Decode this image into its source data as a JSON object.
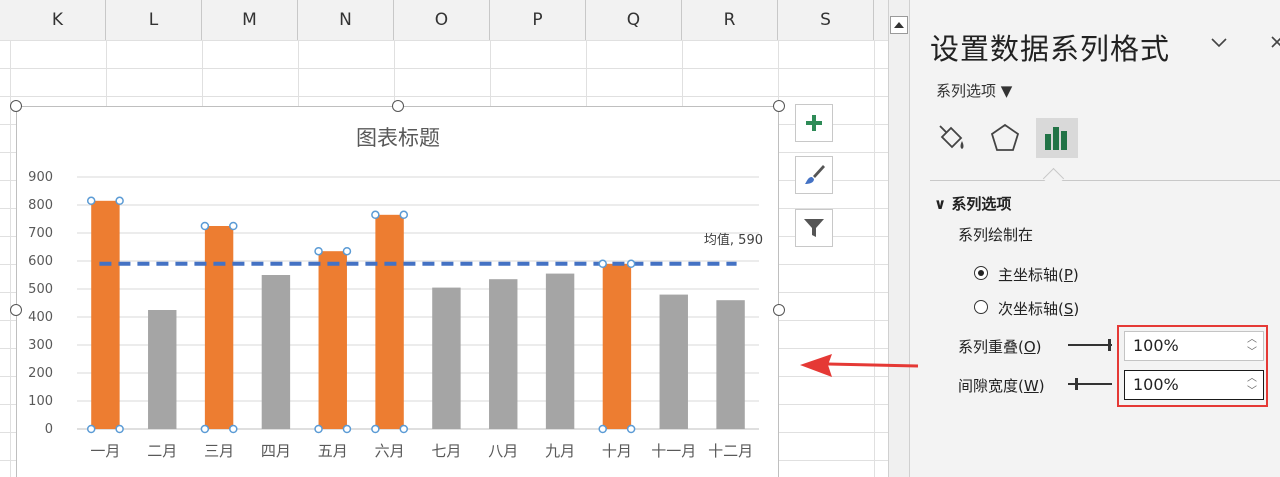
{
  "spreadsheet": {
    "columns": [
      "K",
      "L",
      "M",
      "N",
      "O",
      "P",
      "Q",
      "R",
      "S"
    ]
  },
  "chart_data": {
    "type": "bar",
    "title": "图表标题",
    "categories": [
      "一月",
      "二月",
      "三月",
      "四月",
      "五月",
      "六月",
      "七月",
      "八月",
      "九月",
      "十月",
      "十一月",
      "十二月"
    ],
    "values": [
      815,
      425,
      725,
      550,
      635,
      765,
      505,
      535,
      555,
      590,
      480,
      460
    ],
    "highlighted": [
      true,
      false,
      true,
      false,
      true,
      true,
      false,
      false,
      false,
      true,
      false,
      false
    ],
    "average": 590,
    "average_label": "均值, 590",
    "ylim": [
      0,
      900
    ],
    "yticks": [
      0,
      100,
      200,
      300,
      400,
      500,
      600,
      700,
      800,
      900
    ],
    "grid": true,
    "colors": {
      "highlight": "#ed7d31",
      "normal": "#a5a5a5",
      "average_line": "#4472c4",
      "selection": "#5b9bd5"
    }
  },
  "chart_tools": [
    "add-element",
    "styles",
    "filter"
  ],
  "pane": {
    "title": "设置数据系列格式",
    "dropdown_icon": "chevron-down",
    "close_icon": "close",
    "series_options_menu": "系列选项 ▼",
    "tabs": [
      "fill-line",
      "effects",
      "series-options"
    ],
    "section_title": "系列选项",
    "plot_on_label": "系列绘制在",
    "primary_axis": {
      "text": "主坐标轴(",
      "key": "P",
      "end": ")",
      "selected": true
    },
    "secondary_axis": {
      "text": "次坐标轴(",
      "key": "S",
      "end": ")",
      "selected": false
    },
    "overlap": {
      "text": "系列重叠(",
      "key": "O",
      "end": ")",
      "value": "100%"
    },
    "gap": {
      "text": "间隙宽度(",
      "key": "W",
      "end": ")",
      "value": "100%"
    }
  },
  "annotation": {
    "arrow_color": "#e53935",
    "box_color": "#e53935"
  }
}
